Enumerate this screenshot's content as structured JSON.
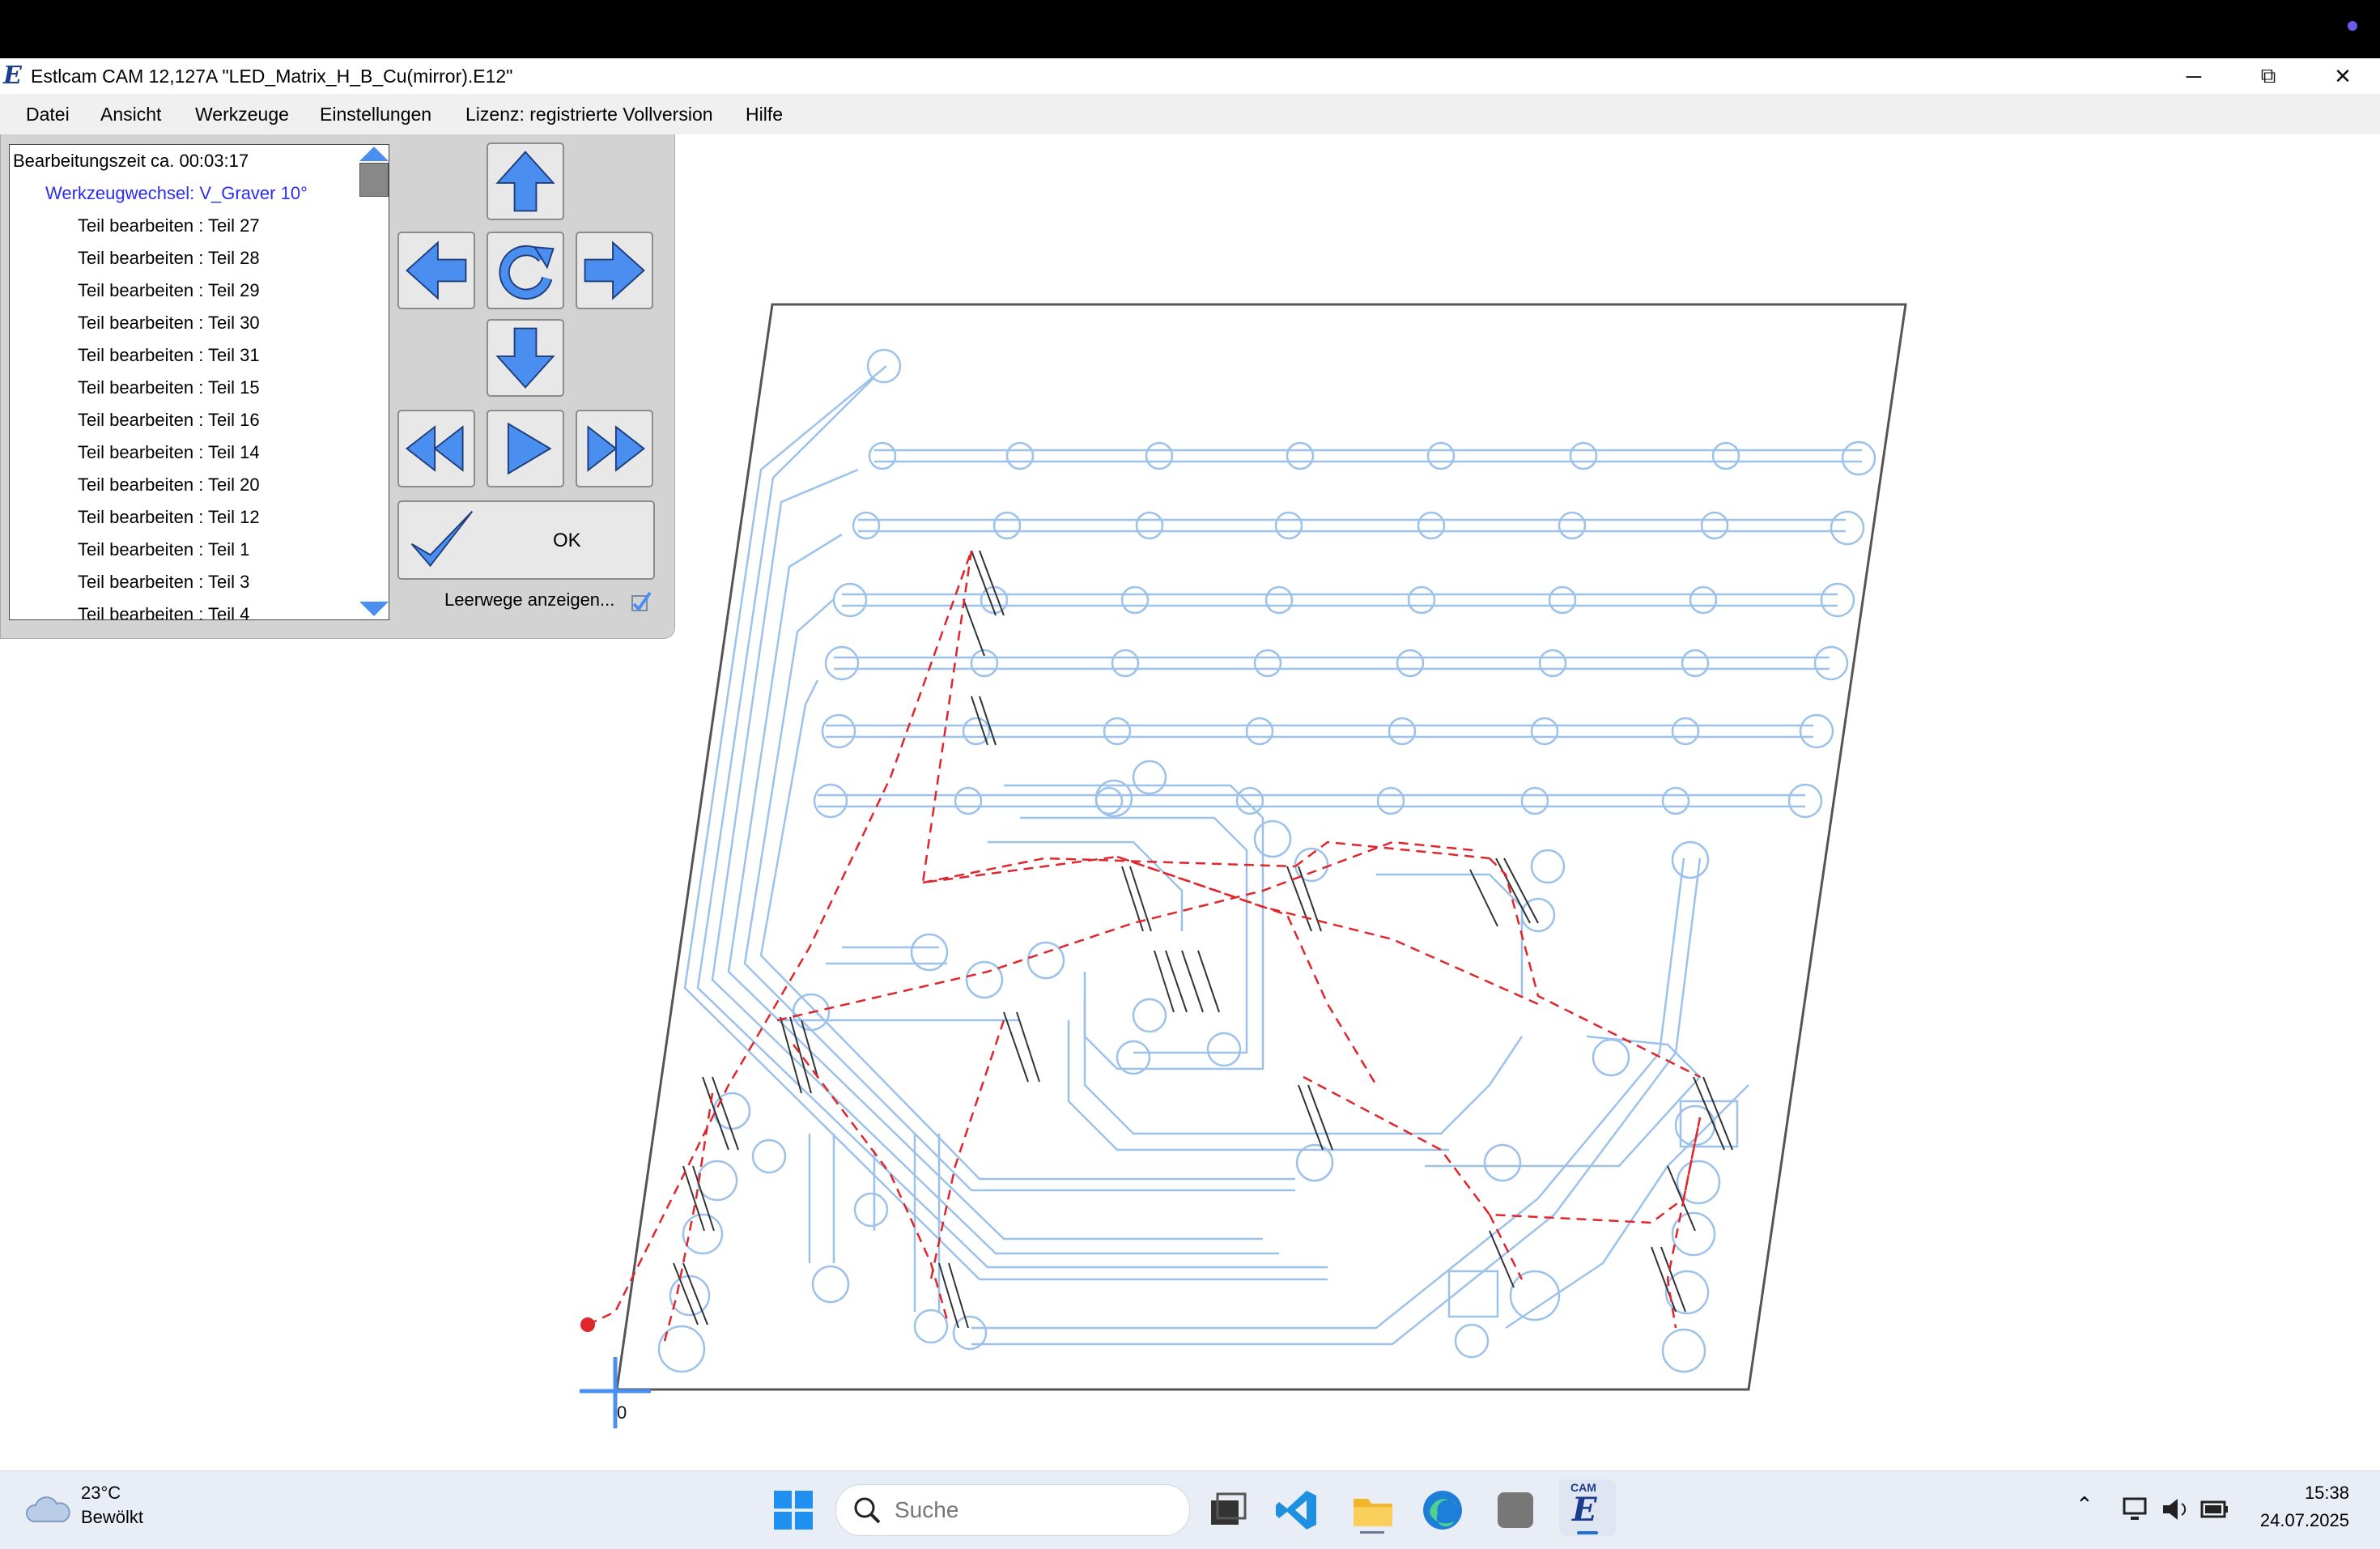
{
  "window": {
    "title": "Estlcam CAM 12,127A \"LED_Matrix_H_B_Cu(mirror).E12\"",
    "app_icon": "E",
    "minimize_glyph": "─",
    "restore_glyph": "⧉",
    "close_glyph": "✕"
  },
  "menu": {
    "items": [
      "Datei",
      "Ansicht",
      "Werkzeuge",
      "Einstellungen",
      "Lizenz: registrierte Vollversion",
      "Hilfe"
    ]
  },
  "sidebar": {
    "header": "Bearbeitungszeit ca. 00:03:17",
    "tool_change": "Werkzeugwechsel: V_Graver 10°",
    "items": [
      "Teil bearbeiten : Teil 27",
      "Teil bearbeiten : Teil 28",
      "Teil bearbeiten : Teil 29",
      "Teil bearbeiten : Teil 30",
      "Teil bearbeiten : Teil 31",
      "Teil bearbeiten : Teil 15",
      "Teil bearbeiten : Teil 16",
      "Teil bearbeiten : Teil 14",
      "Teil bearbeiten : Teil 20",
      "Teil bearbeiten : Teil 12",
      "Teil bearbeiten : Teil 1",
      "Teil bearbeiten : Teil 3",
      "Teil bearbeiten : Teil 4"
    ]
  },
  "controls": {
    "ok_label": "OK",
    "leerwege_label": "Leerwege anzeigen..."
  },
  "canvas": {
    "origin_label": "0"
  },
  "taskbar": {
    "temperature": "23°C",
    "condition": "Bewölkt",
    "search_placeholder": "Suche",
    "time": "15:38",
    "date": "24.07.2025",
    "cam_label": "CAM"
  },
  "colors": {
    "accent_blue": "#4a8ff0",
    "trace_blue": "#9cc2ec",
    "rapid_red": "#e0252b",
    "tool_change_blue": "#2c2cf0"
  }
}
